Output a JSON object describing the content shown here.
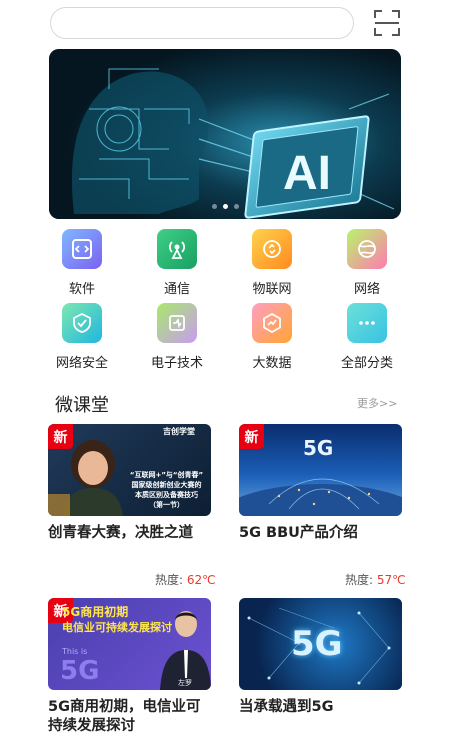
{
  "search": {
    "placeholder": ""
  },
  "categories": [
    {
      "label": "软件",
      "icon": "code-icon",
      "color_from": "#7fb8ff",
      "color_to": "#7b61f0"
    },
    {
      "label": "通信",
      "icon": "antenna-icon",
      "color_from": "#3fcf87",
      "color_to": "#19a062"
    },
    {
      "label": "物联网",
      "icon": "link-icon",
      "color_from": "#ffd24d",
      "color_to": "#ff8a1f"
    },
    {
      "label": "网络",
      "icon": "globe-icon",
      "color_from": "#b7f56a",
      "color_to": "#ff7ab0"
    },
    {
      "label": "网络安全",
      "icon": "shield-icon",
      "color_from": "#7de8b0",
      "color_to": "#1fb6e0"
    },
    {
      "label": "电子技术",
      "icon": "circuit-icon",
      "color_from": "#a9e86a",
      "color_to": "#c89cf2"
    },
    {
      "label": "大数据",
      "icon": "chart-icon",
      "color_from": "#ff9fc2",
      "color_to": "#ffa532"
    },
    {
      "label": "全部分类",
      "icon": "more-icon",
      "color_from": "#6ce0d8",
      "color_to": "#39c2e3"
    }
  ],
  "section": {
    "title": "微课堂",
    "more": "更多>>"
  },
  "cards": [
    {
      "badge": "新",
      "title": "创青春大赛，决胜之道",
      "heat_label": "热度:",
      "heat_value": "62℃",
      "thumb": {
        "logo": "吉创学堂",
        "line1": "“互联网+”与“创青春”",
        "line2": "国家级创新创业大赛的",
        "line3": "本质区别及备赛技巧",
        "line4": "（第一节）"
      }
    },
    {
      "badge": "新",
      "title": "5G BBU产品介绍",
      "heat_label": "热度:",
      "heat_value": "57℃",
      "thumb": {
        "logo": "5G"
      }
    },
    {
      "badge": "新",
      "title": "5G商用初期，电信业可持续发展探讨",
      "heat_label": "",
      "heat_value": "",
      "thumb": {
        "line1": "5G商用初期",
        "line2": "电信业可持续发展探讨",
        "big": "5G",
        "small": "This is",
        "name": "左罗"
      }
    },
    {
      "badge": "",
      "title": "当承载遇到5G",
      "heat_label": "",
      "heat_value": "",
      "thumb": {
        "logo": "5G"
      }
    }
  ],
  "banner": {
    "text": "AI"
  }
}
